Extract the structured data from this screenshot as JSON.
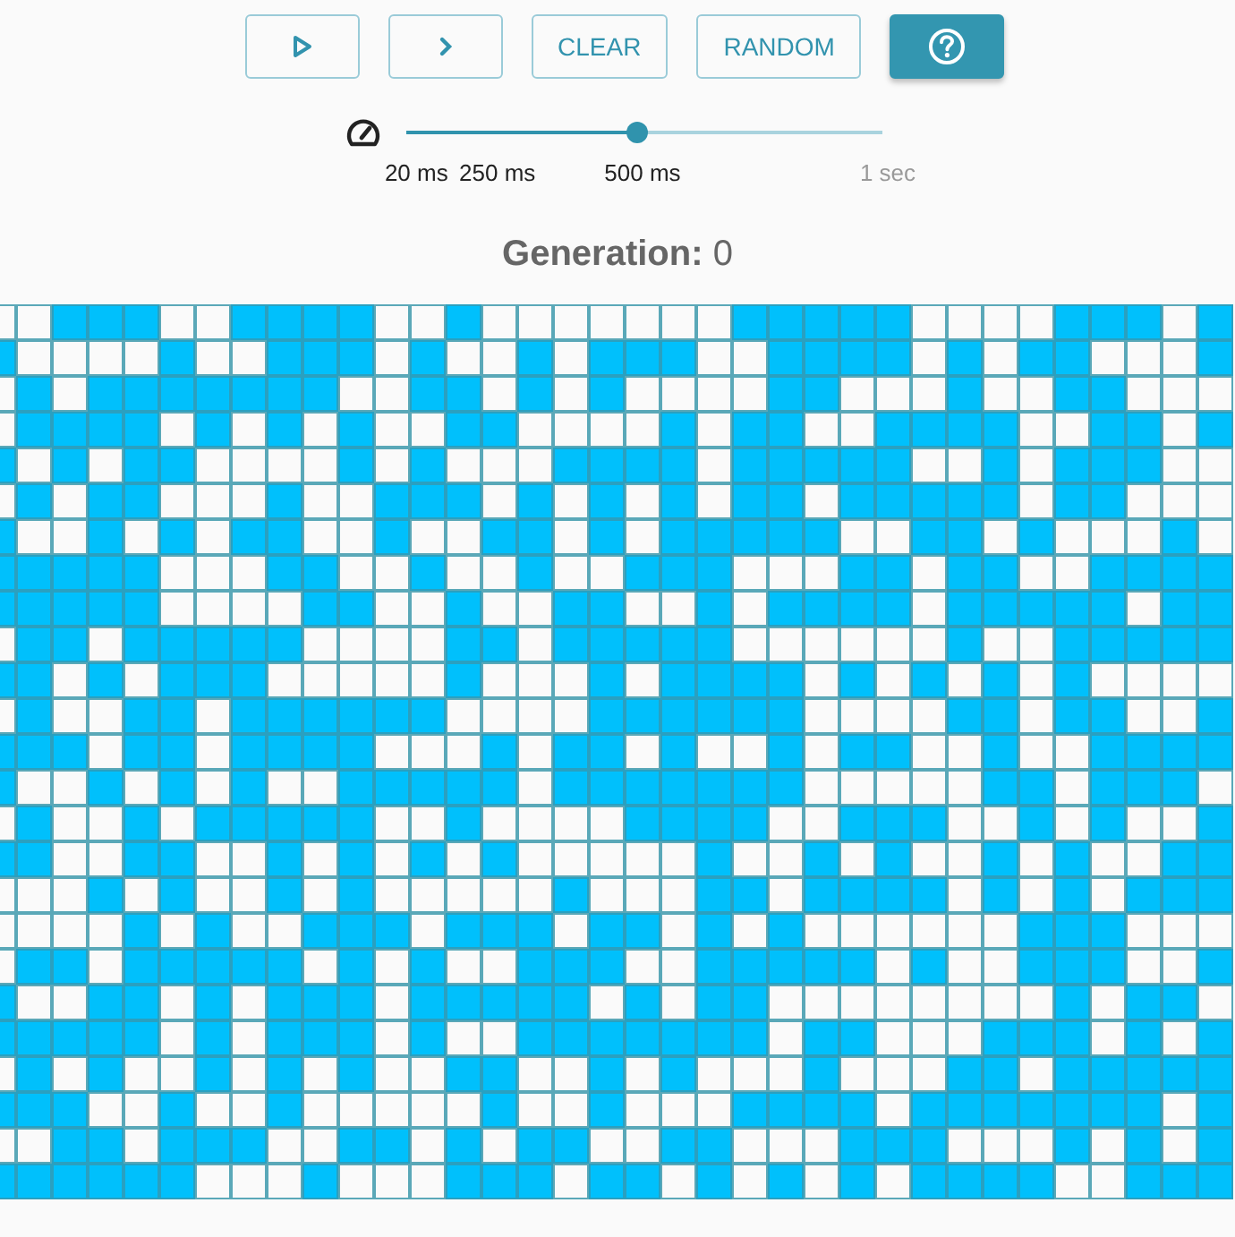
{
  "buttons": [
    {
      "kind": "play",
      "primary": false
    },
    {
      "kind": "step",
      "primary": false
    },
    {
      "kind": "text",
      "label": "CLEAR",
      "primary": false
    },
    {
      "kind": "text",
      "label": "RANDOM",
      "primary": false
    },
    {
      "kind": "help",
      "primary": true
    }
  ],
  "slider": {
    "level": 0.485,
    "marks": [
      {
        "label": "20 ms",
        "active": true
      },
      {
        "label": "250 ms",
        "active": true
      },
      {
        "label": "500 ms",
        "active": true
      },
      {
        "label": "1 sec",
        "active": false
      }
    ]
  },
  "generation": {
    "text": "**Generation:** 0"
  },
  "grid": {
    "rows": [
      [
        false,
        false,
        true,
        true,
        true,
        false,
        false,
        true,
        true,
        true,
        true,
        false,
        false,
        true,
        false,
        false,
        false,
        false,
        false,
        false,
        false,
        true,
        true,
        true,
        true,
        true,
        false,
        false,
        false,
        false,
        true,
        true,
        true,
        false,
        true
      ],
      [
        true,
        false,
        false,
        false,
        false,
        true,
        false,
        false,
        true,
        true,
        true,
        false,
        true,
        false,
        false,
        true,
        false,
        true,
        true,
        true,
        false,
        false,
        true,
        true,
        true,
        true,
        false,
        true,
        false,
        true,
        true,
        false,
        false,
        false,
        true
      ],
      [
        false,
        true,
        false,
        true,
        true,
        true,
        true,
        true,
        true,
        true,
        false,
        false,
        true,
        true,
        false,
        true,
        false,
        true,
        false,
        false,
        false,
        false,
        true,
        true,
        false,
        false,
        false,
        true,
        false,
        false,
        true,
        true,
        false,
        false,
        false
      ],
      [
        false,
        true,
        true,
        true,
        true,
        false,
        true,
        false,
        true,
        false,
        true,
        false,
        false,
        true,
        true,
        false,
        false,
        false,
        false,
        true,
        false,
        true,
        true,
        false,
        false,
        true,
        true,
        true,
        true,
        false,
        false,
        true,
        true,
        false,
        true
      ],
      [
        true,
        false,
        true,
        false,
        true,
        true,
        false,
        false,
        false,
        false,
        true,
        false,
        true,
        false,
        false,
        false,
        true,
        true,
        true,
        true,
        false,
        true,
        true,
        true,
        true,
        true,
        false,
        false,
        true,
        false,
        true,
        true,
        true,
        false,
        false
      ],
      [
        false,
        true,
        false,
        true,
        true,
        false,
        false,
        false,
        true,
        false,
        false,
        true,
        true,
        true,
        false,
        true,
        false,
        true,
        false,
        true,
        false,
        true,
        true,
        false,
        true,
        true,
        true,
        true,
        true,
        false,
        true,
        true,
        false,
        false,
        false
      ],
      [
        true,
        false,
        false,
        true,
        false,
        true,
        false,
        true,
        true,
        false,
        false,
        true,
        false,
        false,
        true,
        true,
        false,
        true,
        false,
        true,
        true,
        true,
        true,
        true,
        false,
        false,
        true,
        true,
        false,
        true,
        false,
        false,
        false,
        true,
        false
      ],
      [
        true,
        true,
        true,
        true,
        true,
        false,
        false,
        false,
        true,
        true,
        false,
        false,
        true,
        false,
        false,
        true,
        false,
        false,
        true,
        true,
        true,
        false,
        false,
        false,
        true,
        true,
        false,
        true,
        true,
        false,
        false,
        true,
        true,
        true,
        true
      ],
      [
        true,
        true,
        true,
        true,
        true,
        false,
        false,
        false,
        false,
        true,
        true,
        false,
        false,
        true,
        false,
        false,
        true,
        true,
        false,
        false,
        true,
        false,
        true,
        true,
        true,
        true,
        false,
        true,
        true,
        true,
        true,
        true,
        false,
        true,
        true
      ],
      [
        false,
        true,
        true,
        false,
        true,
        true,
        true,
        true,
        true,
        false,
        false,
        false,
        false,
        true,
        true,
        false,
        true,
        true,
        true,
        true,
        true,
        false,
        false,
        false,
        false,
        false,
        false,
        true,
        false,
        false,
        true,
        true,
        true,
        true,
        true
      ],
      [
        true,
        true,
        false,
        true,
        false,
        true,
        true,
        true,
        false,
        false,
        false,
        false,
        false,
        true,
        false,
        false,
        false,
        true,
        false,
        true,
        true,
        true,
        true,
        false,
        true,
        false,
        true,
        false,
        true,
        false,
        true,
        false,
        false,
        false,
        false
      ],
      [
        false,
        true,
        false,
        false,
        true,
        true,
        false,
        true,
        true,
        true,
        true,
        true,
        true,
        false,
        false,
        false,
        false,
        true,
        true,
        true,
        true,
        true,
        true,
        false,
        false,
        false,
        false,
        true,
        true,
        false,
        true,
        true,
        false,
        false,
        true
      ],
      [
        true,
        true,
        true,
        false,
        true,
        true,
        false,
        true,
        true,
        true,
        true,
        false,
        false,
        false,
        true,
        false,
        true,
        true,
        false,
        true,
        false,
        false,
        true,
        false,
        true,
        true,
        false,
        false,
        true,
        false,
        false,
        true,
        true,
        true,
        true
      ],
      [
        true,
        false,
        false,
        true,
        false,
        true,
        false,
        true,
        false,
        false,
        true,
        true,
        true,
        true,
        true,
        false,
        true,
        true,
        true,
        true,
        true,
        true,
        true,
        false,
        false,
        false,
        false,
        false,
        true,
        true,
        false,
        true,
        true,
        true,
        false
      ],
      [
        false,
        true,
        false,
        false,
        true,
        false,
        true,
        true,
        true,
        true,
        true,
        false,
        false,
        true,
        false,
        false,
        false,
        false,
        true,
        true,
        true,
        true,
        false,
        false,
        true,
        true,
        true,
        false,
        false,
        true,
        false,
        true,
        false,
        false,
        true
      ],
      [
        true,
        true,
        false,
        false,
        true,
        true,
        false,
        false,
        true,
        false,
        true,
        false,
        true,
        false,
        true,
        false,
        false,
        false,
        false,
        false,
        true,
        false,
        false,
        true,
        false,
        true,
        false,
        false,
        true,
        false,
        true,
        false,
        false,
        true,
        true
      ],
      [
        false,
        false,
        false,
        true,
        false,
        true,
        false,
        false,
        true,
        false,
        true,
        false,
        false,
        false,
        false,
        false,
        true,
        false,
        false,
        false,
        true,
        true,
        false,
        true,
        true,
        true,
        true,
        false,
        true,
        false,
        true,
        false,
        true,
        true,
        true
      ],
      [
        false,
        false,
        false,
        false,
        true,
        false,
        true,
        false,
        false,
        true,
        true,
        true,
        false,
        true,
        true,
        true,
        false,
        true,
        true,
        false,
        true,
        false,
        true,
        false,
        false,
        false,
        false,
        false,
        false,
        true,
        true,
        true,
        false,
        false,
        false
      ],
      [
        false,
        true,
        true,
        false,
        true,
        true,
        true,
        true,
        true,
        false,
        true,
        false,
        true,
        false,
        false,
        true,
        true,
        true,
        false,
        false,
        true,
        true,
        true,
        true,
        true,
        false,
        true,
        false,
        false,
        true,
        true,
        true,
        false,
        false,
        true
      ],
      [
        true,
        false,
        false,
        true,
        true,
        false,
        true,
        false,
        true,
        true,
        true,
        false,
        true,
        true,
        true,
        true,
        true,
        false,
        true,
        false,
        true,
        true,
        false,
        false,
        false,
        false,
        false,
        false,
        false,
        false,
        true,
        false,
        true,
        true,
        false
      ],
      [
        true,
        true,
        true,
        true,
        true,
        false,
        true,
        false,
        true,
        true,
        true,
        false,
        true,
        false,
        false,
        true,
        true,
        true,
        true,
        true,
        true,
        true,
        false,
        true,
        true,
        false,
        false,
        false,
        true,
        true,
        true,
        false,
        true,
        false,
        true
      ],
      [
        false,
        true,
        false,
        true,
        false,
        false,
        true,
        false,
        true,
        false,
        true,
        false,
        false,
        true,
        true,
        false,
        false,
        true,
        false,
        true,
        false,
        false,
        false,
        true,
        false,
        false,
        false,
        true,
        true,
        false,
        true,
        true,
        true,
        true,
        true
      ],
      [
        true,
        true,
        true,
        false,
        false,
        true,
        false,
        false,
        true,
        false,
        false,
        false,
        false,
        false,
        true,
        false,
        false,
        true,
        false,
        false,
        false,
        true,
        true,
        true,
        true,
        false,
        true,
        true,
        true,
        true,
        true,
        true,
        true,
        false,
        true
      ],
      [
        false,
        false,
        true,
        true,
        false,
        true,
        true,
        true,
        false,
        false,
        true,
        true,
        false,
        true,
        false,
        true,
        true,
        false,
        false,
        true,
        true,
        false,
        false,
        false,
        true,
        true,
        true,
        false,
        false,
        false,
        true,
        false,
        true,
        false,
        true
      ],
      [
        true,
        true,
        true,
        true,
        true,
        true,
        false,
        false,
        false,
        true,
        false,
        false,
        false,
        true,
        true,
        true,
        false,
        true,
        true,
        false,
        true,
        false,
        true,
        false,
        true,
        false,
        true,
        true,
        true,
        true,
        false,
        false,
        true,
        true,
        true
      ]
    ]
  }
}
